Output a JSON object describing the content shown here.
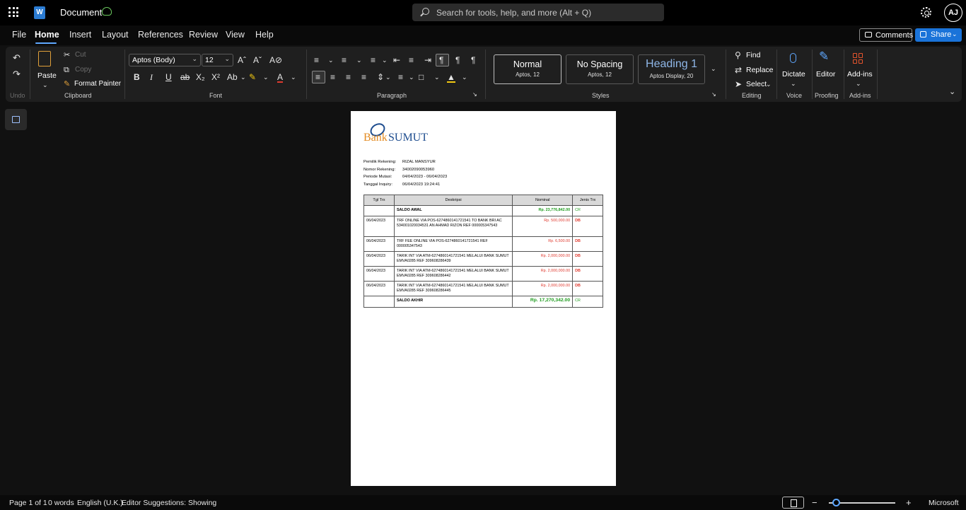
{
  "app": {
    "doc_title": "Document",
    "search_placeholder": "Search for tools, help, and more (Alt + Q)",
    "avatar_initials": "AJ",
    "app_logo_letter": "W"
  },
  "menu": {
    "items": [
      "File",
      "Home",
      "Insert",
      "Layout",
      "References",
      "Review",
      "View",
      "Help"
    ],
    "comments_label": "Comments",
    "share_label": "Share"
  },
  "ribbon": {
    "undo_group": "Undo",
    "clipboard": {
      "paste": "Paste",
      "cut": "Cut",
      "copy": "Copy",
      "format_painter": "Format Painter",
      "group": "Clipboard"
    },
    "font": {
      "family": "Aptos (Body)",
      "size": "12",
      "group": "Font"
    },
    "paragraph": {
      "group": "Paragraph"
    },
    "styles": {
      "group": "Styles",
      "items": [
        {
          "name": "Normal",
          "sub": "Aptos, 12"
        },
        {
          "name": "No Spacing",
          "sub": "Aptos, 12"
        },
        {
          "name": "Heading 1",
          "sub": "Aptos Display, 20"
        }
      ]
    },
    "editing": {
      "find": "Find",
      "replace": "Replace",
      "select": "Select",
      "group": "Editing"
    },
    "voice": {
      "dictate": "Dictate",
      "group": "Voice"
    },
    "proofing": {
      "editor": "Editor",
      "group": "Proofing"
    },
    "addins": {
      "label": "Add-ins",
      "group": "Add-ins"
    }
  },
  "document": {
    "logo_bank": "Bank",
    "logo_sumut": "SUMUT",
    "info": [
      {
        "k": "Pemilik Rekening:",
        "v": "RIZAL MANSYUR"
      },
      {
        "k": "Nomor Rekening:",
        "v": "34002090053960"
      },
      {
        "k": "Periode Mutasi:",
        "v": "04/04/2023 - 06/04/2023"
      },
      {
        "k": "Tanggal Inquiry:",
        "v": "06/04/2023 19:24:41"
      }
    ],
    "table": {
      "headers": [
        "Tgl Trx",
        "Deskripsi",
        "Nominal",
        "Jenis Trx"
      ],
      "rows": [
        {
          "date": "",
          "desc": "SALDO AWAL",
          "nominal": "Rp. 23,776,842.00",
          "type": "CR"
        },
        {
          "date": "06/04/2023",
          "desc": "TRF ONLINE VIA POS-6274860141721541 TO BANK BRI AC 534001020034531 AN AHMAD RIZON  REF 000005347543",
          "nominal": "Rp. 500,000.00",
          "type": "DB"
        },
        {
          "date": "06/04/2023",
          "desc": "TRF FEE ONLINE VIA POS-6274860141721541 REF 000005347543",
          "nominal": "Rp. 6,500.00",
          "type": "DB"
        },
        {
          "date": "06/04/2023",
          "desc": "TARIK INT VIA ATM-6274860141721541 MELALUI BANK SUMUT EMVA0285 REF 309608286439",
          "nominal": "Rp. 2,000,000.00",
          "type": "DB"
        },
        {
          "date": "06/04/2023",
          "desc": "TARIK INT VIA ATM-6274860141721541 MELALUI BANK SUMUT EMVA0285 REF 309608286442",
          "nominal": "Rp. 2,000,000.00",
          "type": "DB"
        },
        {
          "date": "06/04/2023",
          "desc": "TARIK INT VIA ATM-6274860141721541 MELALUI BANK SUMUT EMVA0285 REF 309608286445",
          "nominal": "Rp. 2,000,000.00",
          "type": "DB"
        },
        {
          "date": "",
          "desc": "SALDO AKHIR",
          "nominal": "Rp. 17,270,342.00",
          "type": "CR"
        }
      ]
    }
  },
  "status": {
    "page": "Page 1 of 1",
    "words": "0 words",
    "language": "English (U.K.)",
    "editor_suggestions": "Editor Suggestions: Showing",
    "zoom_right_label": "Microsoft",
    "zoom_out": "−",
    "zoom_in": "+"
  },
  "colors": {
    "accent": "#1a73d9",
    "debit": "#e03a2f",
    "credit": "#1e9b1e",
    "brand_orange": "#e38b22",
    "brand_blue": "#1e4d8f"
  }
}
